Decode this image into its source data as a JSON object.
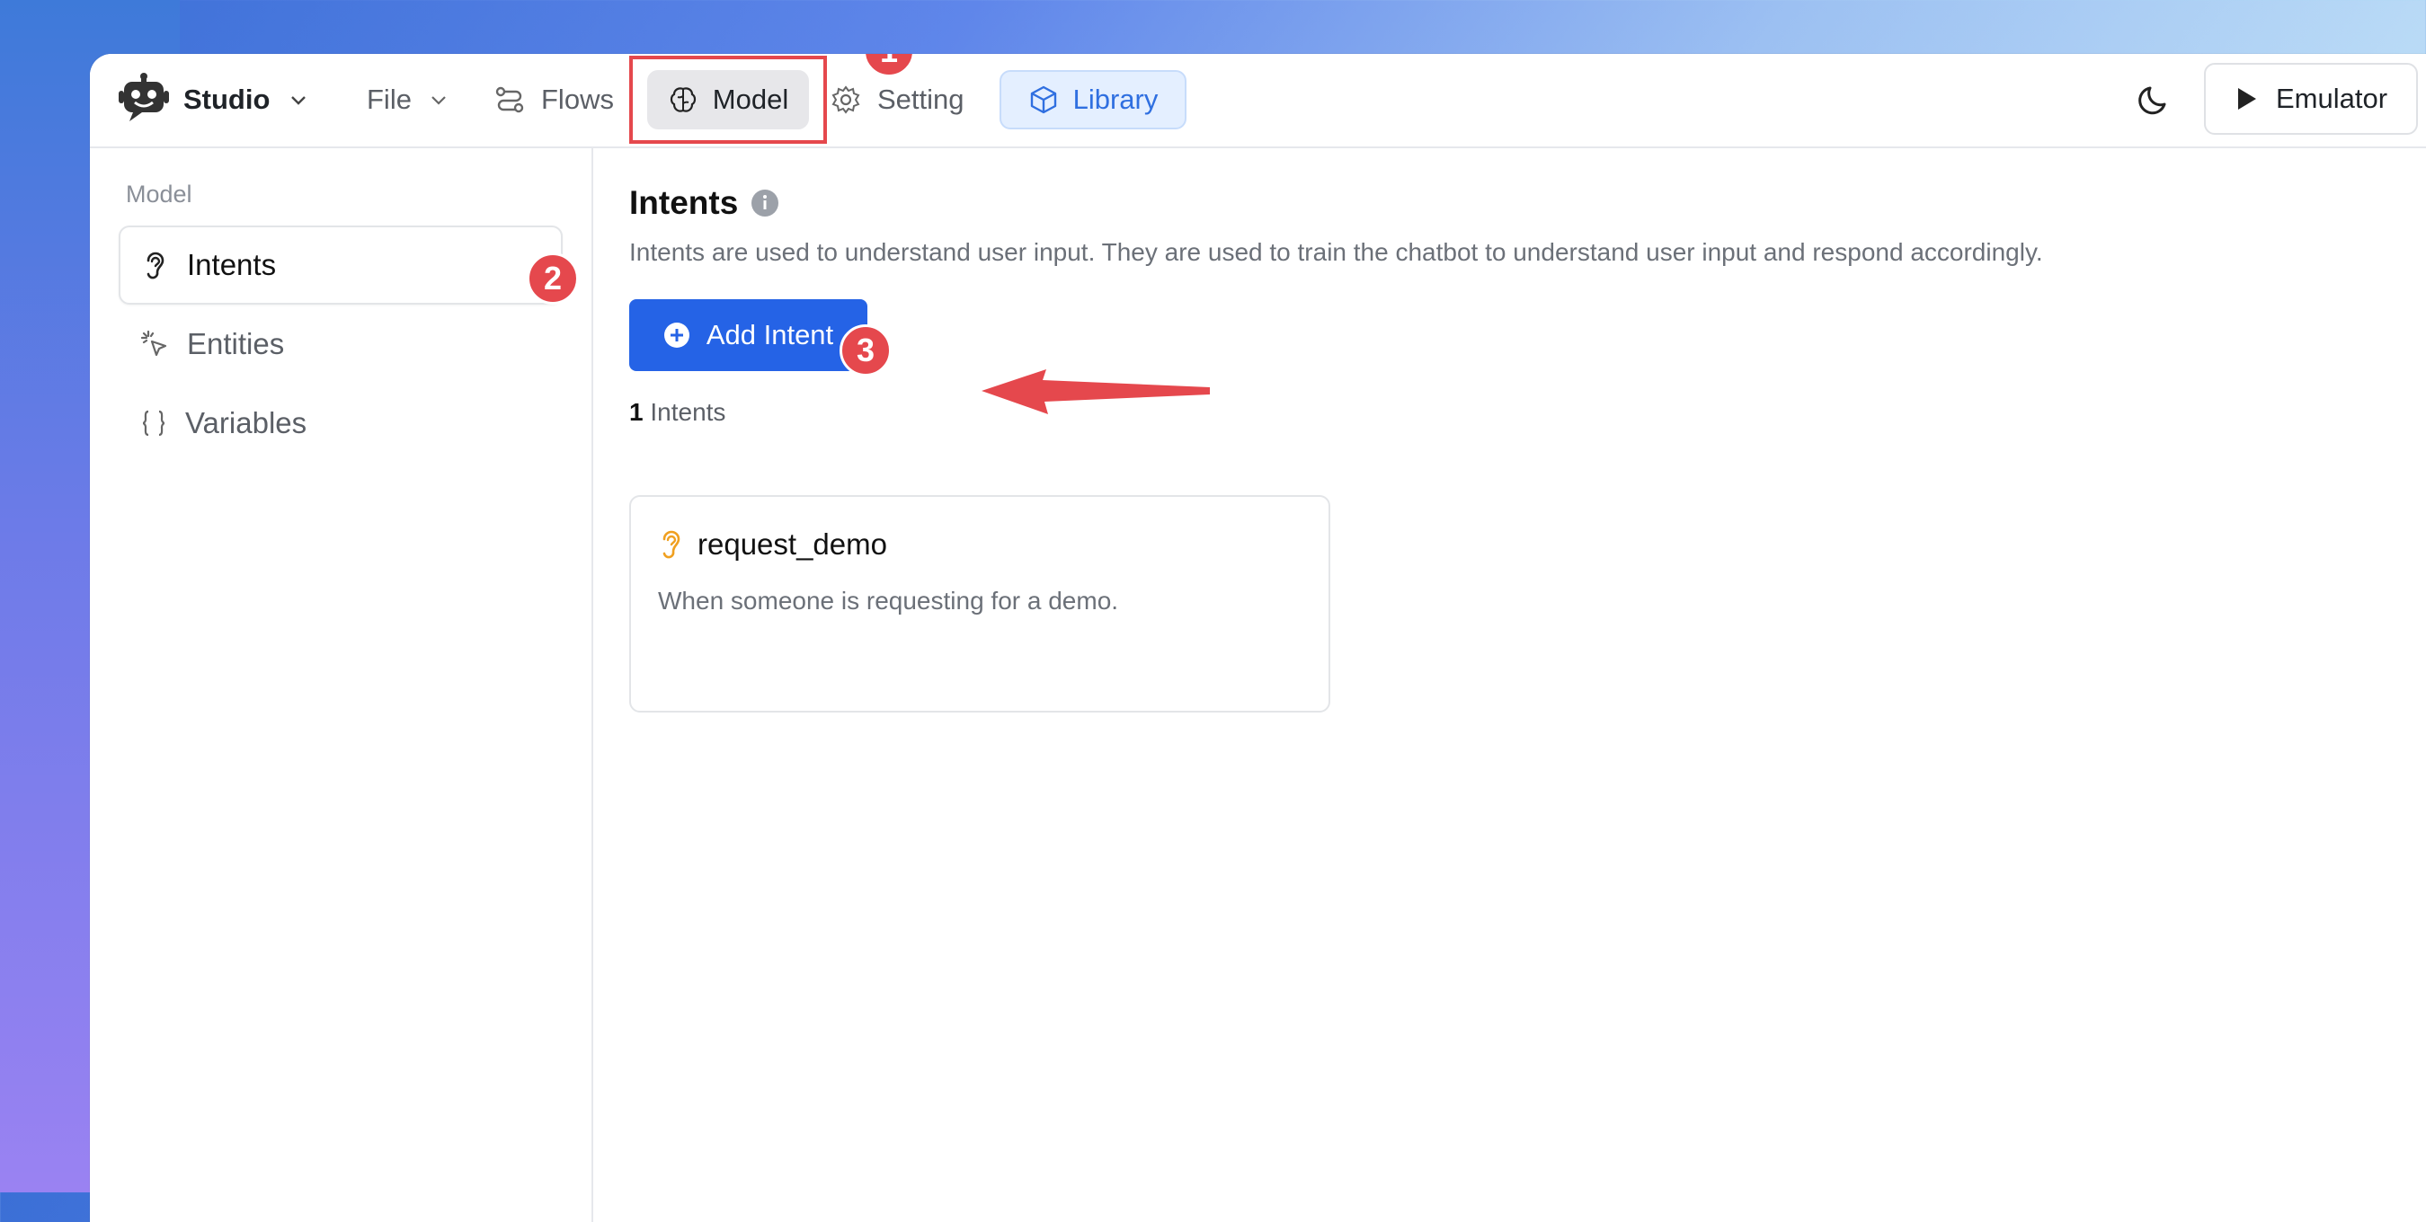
{
  "topbar": {
    "brand": "Studio",
    "file": "File",
    "flows": "Flows",
    "model": "Model",
    "setting": "Setting",
    "library": "Library",
    "emulator": "Emulator"
  },
  "sidebar": {
    "section": "Model",
    "items": [
      {
        "label": "Intents",
        "icon": "ear-icon",
        "active": true
      },
      {
        "label": "Entities",
        "icon": "cursor-click-icon",
        "active": false
      },
      {
        "label": "Variables",
        "icon": "braces-icon",
        "active": false
      }
    ]
  },
  "main": {
    "title": "Intents",
    "description": "Intents are used to understand user input. They are used to train the chatbot to understand user input and respond accordingly.",
    "add_button": "Add Intent",
    "count_number": "1",
    "count_label": "Intents",
    "intents": [
      {
        "name": "request_demo",
        "description": "When someone is requesting for a demo."
      }
    ]
  },
  "annotations": {
    "badges": [
      "1",
      "2",
      "3"
    ]
  },
  "colors": {
    "accent": "#2563e6",
    "annotation": "#e5484d",
    "library_bg": "#e4efff",
    "intent_icon": "#f0a020"
  }
}
